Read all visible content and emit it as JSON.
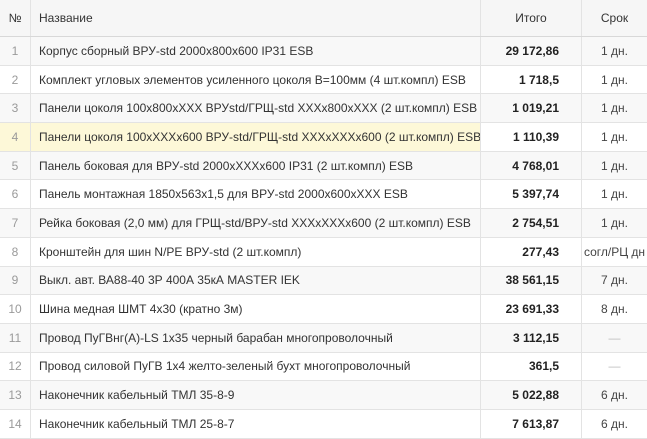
{
  "headers": {
    "num": "№",
    "name": "Название",
    "total": "Итого",
    "term": "Срок"
  },
  "rows": [
    {
      "num": "1",
      "name": "Корпус сборный ВРУ-std 2000х800х600 IP31 ESB",
      "total": "29 172,86",
      "term": "1 дн."
    },
    {
      "num": "2",
      "name": "Комплект угловых элементов усиленного цоколя B=100мм (4 шт.компл) ESB",
      "total": "1 718,5",
      "term": "1 дн."
    },
    {
      "num": "3",
      "name": "Панели цоколя 100х800хXXX ВРУstd/ГРЩ-std XXXх800хXXX (2 шт.компл) ESB",
      "total": "1 019,21",
      "term": "1 дн."
    },
    {
      "num": "4",
      "name": "Панели цоколя 100хXXXх600 ВРУ-std/ГРЩ-std XXXхXXXх600 (2 шт.компл) ESB",
      "total": "1 110,39",
      "term": "1 дн."
    },
    {
      "num": "5",
      "name": "Панель боковая для ВРУ-std 2000хXXXх600 IP31 (2 шт.компл) ESB",
      "total": "4 768,01",
      "term": "1 дн."
    },
    {
      "num": "6",
      "name": "Панель монтажная 1850х563х1,5 для ВРУ-std 2000х600хXXX ESB",
      "total": "5 397,74",
      "term": "1 дн."
    },
    {
      "num": "7",
      "name": "Рейка боковая (2,0 мм) для ГРЩ-std/ВРУ-std XXXхXXXх600 (2 шт.компл) ESB",
      "total": "2 754,51",
      "term": "1 дн."
    },
    {
      "num": "8",
      "name": "Кронштейн для шин N/PE ВРУ-std (2 шт.компл)",
      "total": "277,43",
      "term": "согл/РЦ дн"
    },
    {
      "num": "9",
      "name": "Выкл. авт. ВА88-40 3Р 400А 35кА MASTER IEK",
      "total": "38 561,15",
      "term": "7 дн."
    },
    {
      "num": "10",
      "name": "Шина медная ШМТ 4х30 (кратно 3м)",
      "total": "23 691,33",
      "term": "8 дн."
    },
    {
      "num": "11",
      "name": "Провод ПуГВнг(А)-LS 1х35 черный барабан многопроволочный",
      "total": "3 112,15",
      "term": "—"
    },
    {
      "num": "12",
      "name": "Провод силовой ПуГВ 1х4 желто-зеленый бухт многопроволочный",
      "total": "361,5",
      "term": "—"
    },
    {
      "num": "13",
      "name": "Наконечник кабельный ТМЛ 35-8-9",
      "total": "5 022,88",
      "term": "6 дн."
    },
    {
      "num": "14",
      "name": "Наконечник кабельный ТМЛ 25-8-7",
      "total": "7 613,87",
      "term": "6 дн."
    }
  ],
  "highlighted_row": "4"
}
